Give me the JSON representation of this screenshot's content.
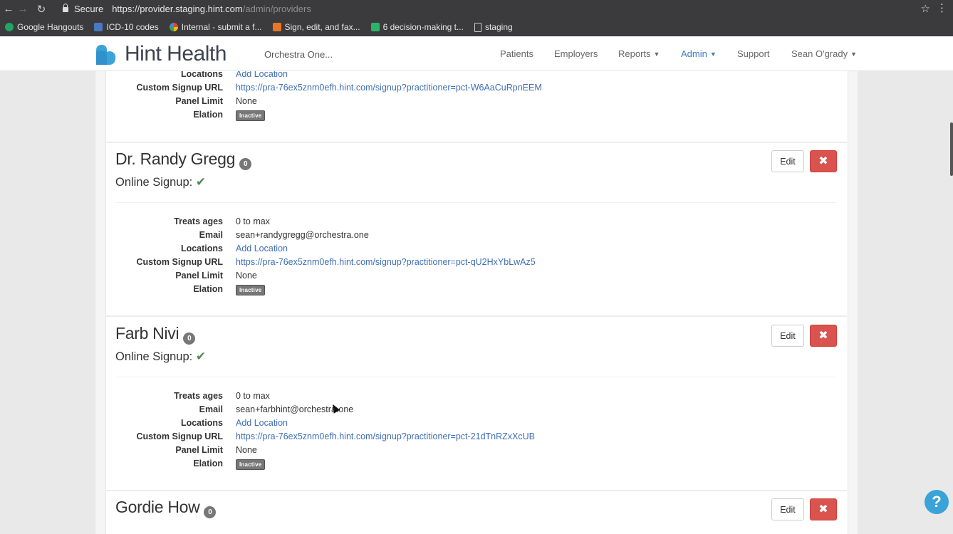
{
  "browser": {
    "secure_label": "Secure",
    "url_main": "https://provider.staging.hint.com",
    "url_path": "/admin/providers",
    "bookmarks": [
      {
        "label": "Google Hangouts",
        "icon": "hangouts-icon",
        "color": "#21a464"
      },
      {
        "label": "ICD-10 codes",
        "icon": "icd-icon",
        "color": "#4a78c2"
      },
      {
        "label": "Internal - submit a f...",
        "icon": "pinwheel-icon",
        "color": "#e0a030"
      },
      {
        "label": "Sign, edit, and fax...",
        "icon": "sign-icon",
        "color": "#e87722"
      },
      {
        "label": "6 decision-making t...",
        "icon": "m-icon",
        "color": "#2bb36a"
      },
      {
        "label": "staging",
        "icon": "page-icon",
        "color": "#cccccc"
      }
    ]
  },
  "header": {
    "brand": "Hint Health",
    "org": "Orchestra One...",
    "nav": {
      "patients": "Patients",
      "employers": "Employers",
      "reports": "Reports",
      "admin": "Admin",
      "support": "Support",
      "user": "Sean O'grady"
    }
  },
  "labels": {
    "treats_ages": "Treats ages",
    "email": "Email",
    "locations": "Locations",
    "custom_signup_url": "Custom Signup URL",
    "panel_limit": "Panel Limit",
    "elation": "Elation",
    "online_signup": "Online Signup:",
    "edit": "Edit",
    "add_location": "Add Location",
    "inactive": "Inactive"
  },
  "partial_provider": {
    "signup_url": "https://pra-76ex5znm0efh.hint.com/signup?practitioner=pct-W6AaCuRpnEEM",
    "panel_limit": "None"
  },
  "providers": [
    {
      "name": "Dr. Randy Gregg",
      "count": "0",
      "treats_ages": "0 to max",
      "email": "sean+randygregg@orchestra.one",
      "signup_url": "https://pra-76ex5znm0efh.hint.com/signup?practitioner=pct-qU2HxYbLwAz5",
      "panel_limit": "None"
    },
    {
      "name": "Farb Nivi",
      "count": "0",
      "treats_ages": "0 to max",
      "email": "sean+farbhint@orchestra.one",
      "signup_url": "https://pra-76ex5znm0efh.hint.com/signup?practitioner=pct-21dTnRZxXcUB",
      "panel_limit": "None"
    },
    {
      "name": "Gordie How",
      "count": "0"
    }
  ],
  "colors": {
    "brand_blue": "#3aa3d8",
    "link": "#3f6fb5",
    "danger": "#d9534f",
    "success_check": "#4f8a4f"
  }
}
